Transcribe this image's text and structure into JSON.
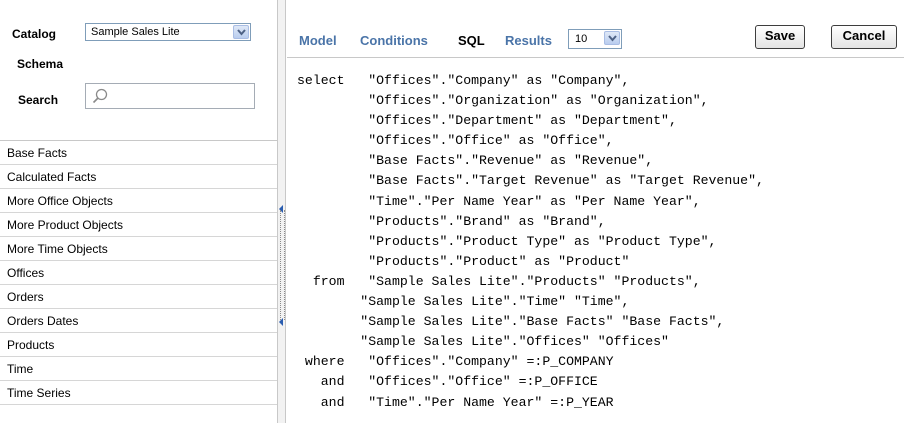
{
  "catalog": {
    "label": "Catalog",
    "selected": "Sample Sales Lite"
  },
  "schema": {
    "label": "Schema"
  },
  "search": {
    "label": "Search",
    "value": ""
  },
  "folders": [
    "Base Facts",
    "Calculated Facts",
    "More Office Objects",
    "More Product Objects",
    "More Time Objects",
    "Offices",
    "Orders",
    "Orders Dates",
    "Products",
    "Time",
    "Time Series"
  ],
  "tabs": {
    "model": "Model",
    "conditions": "Conditions",
    "sql": "SQL",
    "results": "Results",
    "active": "SQL"
  },
  "results_count": "10",
  "buttons": {
    "save": "Save",
    "cancel": "Cancel"
  },
  "sql_lines": [
    "select   \"Offices\".\"Company\" as \"Company\",",
    "         \"Offices\".\"Organization\" as \"Organization\",",
    "         \"Offices\".\"Department\" as \"Department\",",
    "         \"Offices\".\"Office\" as \"Office\",",
    "         \"Base Facts\".\"Revenue\" as \"Revenue\",",
    "         \"Base Facts\".\"Target Revenue\" as \"Target Revenue\",",
    "         \"Time\".\"Per Name Year\" as \"Per Name Year\",",
    "         \"Products\".\"Brand\" as \"Brand\",",
    "         \"Products\".\"Product Type\" as \"Product Type\",",
    "         \"Products\".\"Product\" as \"Product\"",
    "  from   \"Sample Sales Lite\".\"Products\" \"Products\",",
    "        \"Sample Sales Lite\".\"Time\" \"Time\",",
    "        \"Sample Sales Lite\".\"Base Facts\" \"Base Facts\",",
    "        \"Sample Sales Lite\".\"Offices\" \"Offices\"",
    " where   \"Offices\".\"Company\" =:P_COMPANY",
    "   and   \"Offices\".\"Office\" =:P_OFFICE",
    "   and   \"Time\".\"Per Name Year\" =:P_YEAR"
  ]
}
